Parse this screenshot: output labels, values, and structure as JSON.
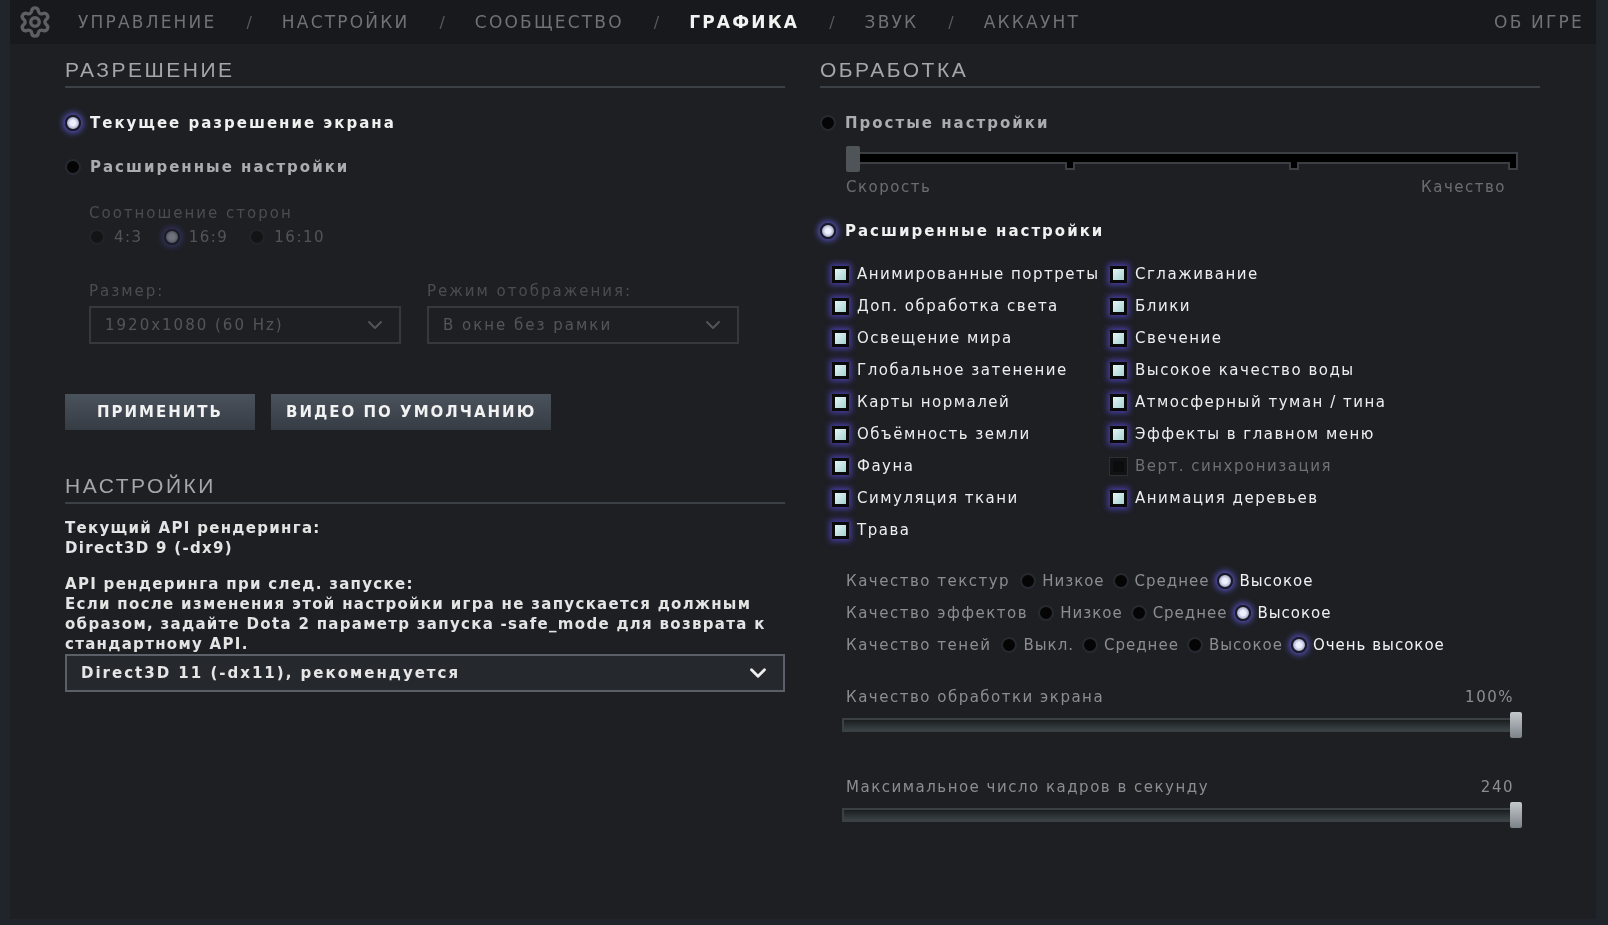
{
  "nav": {
    "separator": "/",
    "items": [
      {
        "label": "УПРАВЛЕНИЕ",
        "selected": false
      },
      {
        "label": "НАСТРОЙКИ",
        "selected": false
      },
      {
        "label": "СООБЩЕСТВО",
        "selected": false
      },
      {
        "label": "ГРАФИКА",
        "selected": true
      },
      {
        "label": "ЗВУК",
        "selected": false
      },
      {
        "label": "АККАУНТ",
        "selected": false
      }
    ],
    "about": "ОБ ИГРЕ"
  },
  "resolution": {
    "title": "РАЗРЕШЕНИЕ",
    "modes": [
      {
        "label": "Текущее разрешение экрана",
        "selected": true
      },
      {
        "label": "Расширенные настройки",
        "selected": false
      }
    ],
    "aspect": {
      "label": "Соотношение сторон",
      "options": [
        {
          "label": "4:3",
          "selected": false
        },
        {
          "label": "16:9",
          "selected": true
        },
        {
          "label": "16:10",
          "selected": false
        }
      ]
    },
    "size": {
      "label": "Размер:",
      "value": "1920x1080 (60 Hz)"
    },
    "display_mode": {
      "label": "Режим отображения:",
      "value": "В окне без рамки"
    },
    "buttons": [
      "ПРИМЕНИТЬ",
      "ВИДЕО ПО УМОЛЧАНИЮ"
    ]
  },
  "settings": {
    "title": "НАСТРОЙКИ",
    "current_api_label": "Текущий API рендеринга:",
    "current_api_value": "Direct3D 9 (-dx9)",
    "next_api_label": "API рендеринга при след. запуске:",
    "warning": "Если после изменения этой настройки игра не запускается должным образом, задайте Dota 2 параметр запуска -safe_mode для возврата к стандартному API.",
    "api_select": "Direct3D 11 (-dx11), рекомендуется"
  },
  "rendering": {
    "title": "ОБРАБОТКА",
    "simple": {
      "label": "Простые настройки",
      "selected": false,
      "level": 0,
      "min_label": "Скорость",
      "max_label": "Качество"
    },
    "advanced": {
      "label": "Расширенные настройки",
      "selected": true
    },
    "checkbox_columns": [
      [
        {
          "label": "Анимированные портреты",
          "checked": true,
          "disabled": false
        },
        {
          "label": "Доп. обработка света",
          "checked": true,
          "disabled": false
        },
        {
          "label": "Освещение мира",
          "checked": true,
          "disabled": false
        },
        {
          "label": "Глобальное затенение",
          "checked": true,
          "disabled": false
        },
        {
          "label": "Карты нормалей",
          "checked": true,
          "disabled": false
        },
        {
          "label": "Объёмность земли",
          "checked": true,
          "disabled": false
        },
        {
          "label": "Фауна",
          "checked": true,
          "disabled": false
        },
        {
          "label": "Симуляция ткани",
          "checked": true,
          "disabled": false
        },
        {
          "label": "Трава",
          "checked": true,
          "disabled": false
        }
      ],
      [
        {
          "label": "Сглаживание",
          "checked": true,
          "disabled": false
        },
        {
          "label": "Блики",
          "checked": true,
          "disabled": false
        },
        {
          "label": "Свечение",
          "checked": true,
          "disabled": false
        },
        {
          "label": "Высокое качество воды",
          "checked": true,
          "disabled": false
        },
        {
          "label": "Атмосферный туман / тина",
          "checked": true,
          "disabled": false
        },
        {
          "label": "Эффекты в главном меню",
          "checked": true,
          "disabled": false
        },
        {
          "label": "Верт. синхронизация",
          "checked": false,
          "disabled": true
        },
        {
          "label": "Анимация деревьев",
          "checked": true,
          "disabled": false
        }
      ]
    ],
    "quality_rows": [
      {
        "label": "Качество текстур",
        "options": [
          {
            "label": "Низкое",
            "selected": false
          },
          {
            "label": "Среднее",
            "selected": false
          },
          {
            "label": "Высокое",
            "selected": true
          }
        ]
      },
      {
        "label": "Качество эффектов",
        "options": [
          {
            "label": "Низкое",
            "selected": false
          },
          {
            "label": "Среднее",
            "selected": false
          },
          {
            "label": "Высокое",
            "selected": true
          }
        ]
      },
      {
        "label": "Качество теней",
        "options": [
          {
            "label": "Выкл.",
            "selected": false
          },
          {
            "label": "Среднее",
            "selected": false
          },
          {
            "label": "Высокое",
            "selected": false
          },
          {
            "label": "Очень высокое",
            "selected": true
          }
        ]
      }
    ],
    "sliders": [
      {
        "label": "Качество обработки экрана",
        "reading": "100%",
        "level": 1
      },
      {
        "label": "Максимальное число кадров в секунду",
        "reading": "240",
        "level": 1
      }
    ]
  }
}
